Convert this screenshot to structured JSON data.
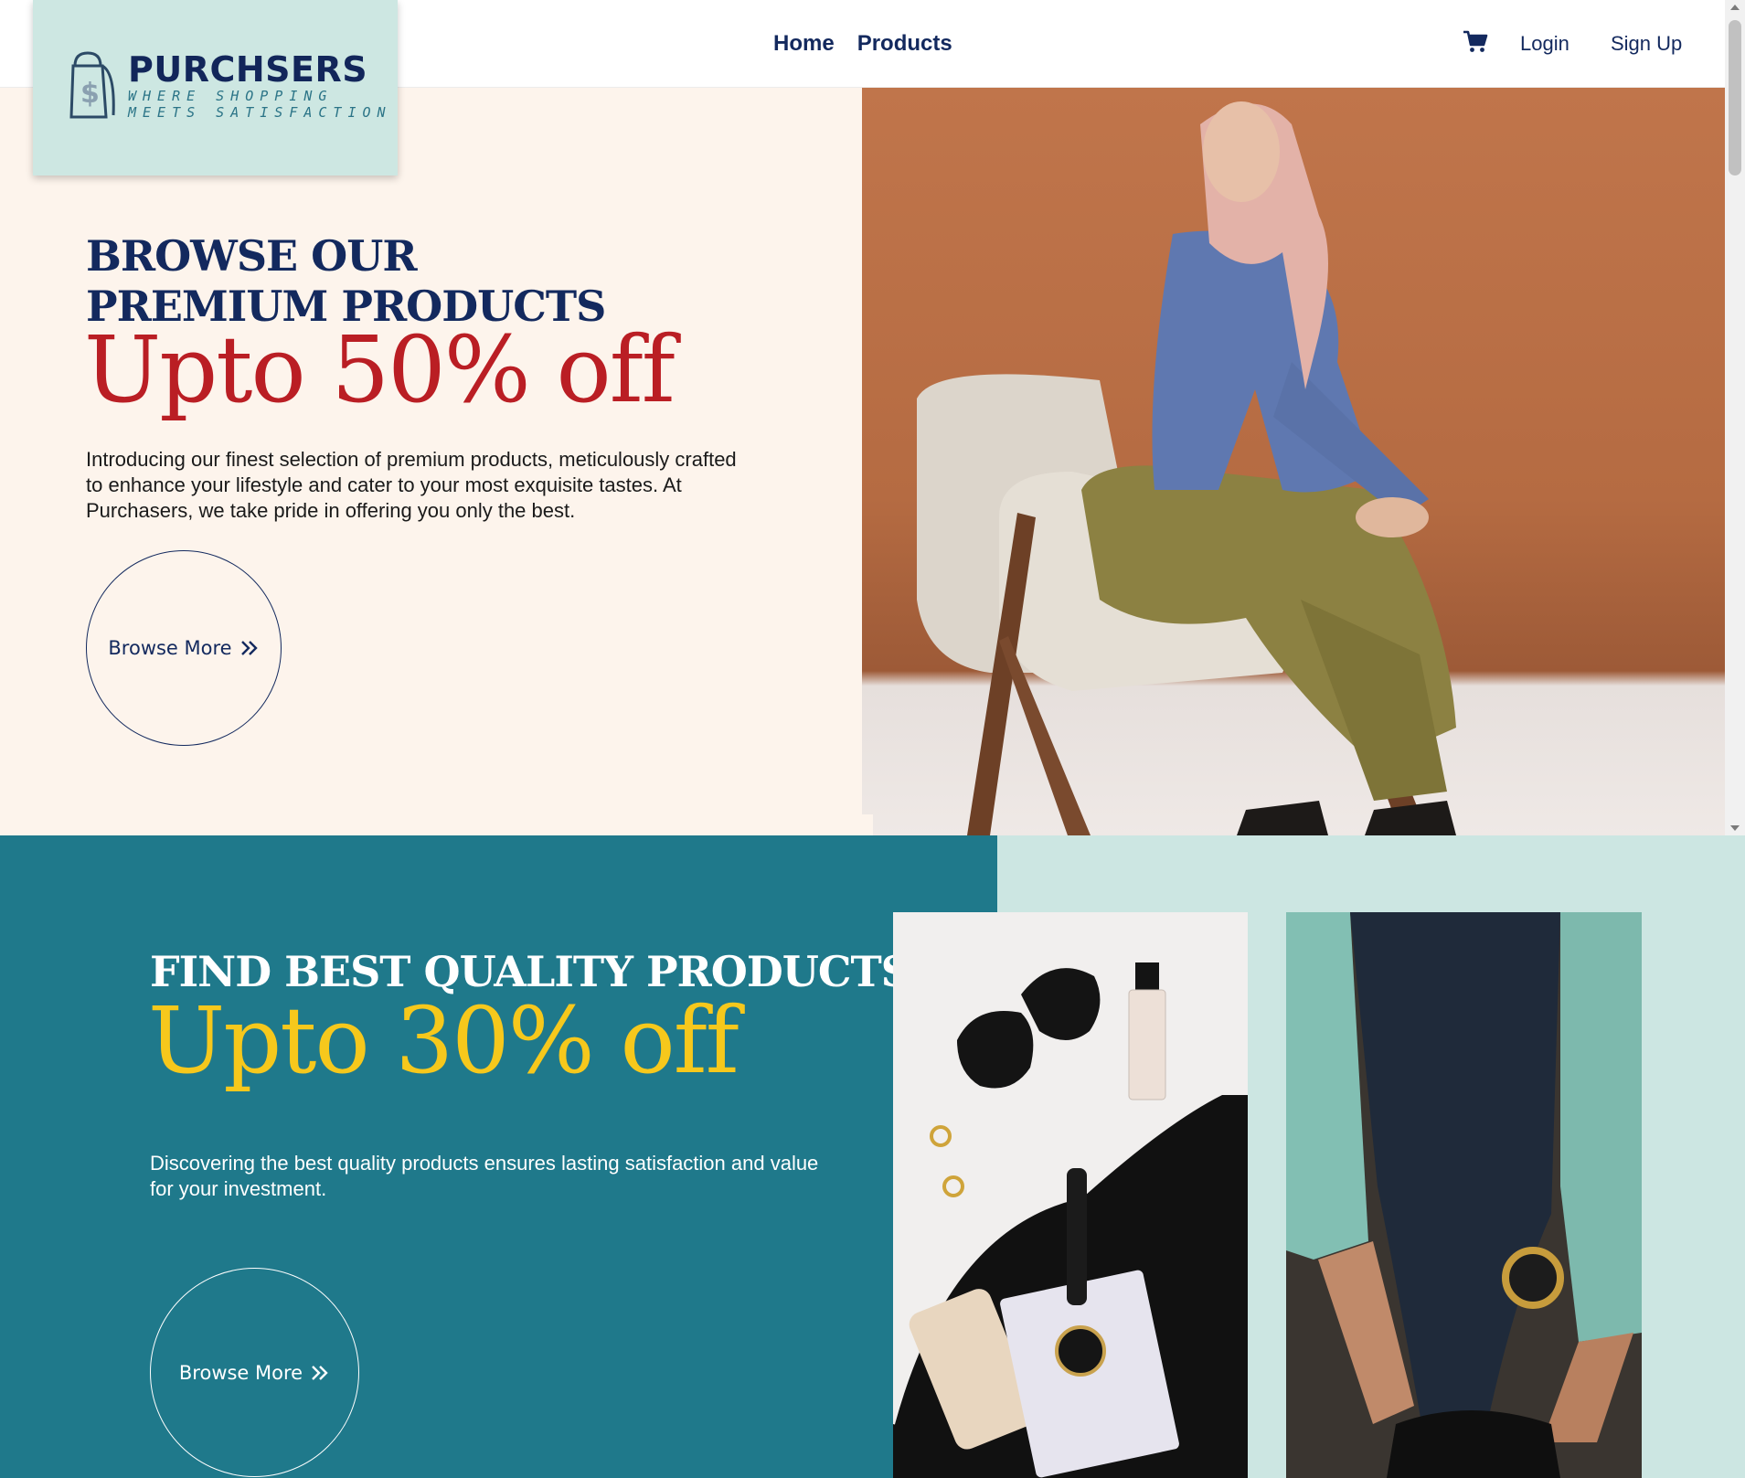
{
  "brand": {
    "name": "PURCHSERS",
    "tagline_line1": "WHERE SHOPPING",
    "tagline_line2": "MEETS SATISFACTION",
    "colors": {
      "navy": "#13295e",
      "teal": "#1f798b",
      "mint": "#cde7e2",
      "red": "#ba1e24",
      "gold": "#f6c81c",
      "cream": "#fdf4ec"
    }
  },
  "nav": {
    "home": "Home",
    "products": "Products",
    "cart_icon": "shopping-cart-icon",
    "login": "Login",
    "signup": "Sign Up"
  },
  "hero1": {
    "title": "BROWSE OUR PREMIUM PRODUCTS",
    "discount": "Upto 50% off",
    "description": "Introducing our finest selection of premium products, meticulously crafted to enhance your lifestyle and cater to your most exquisite tastes. At Purchasers, we take pride in offering you only the best.",
    "button": "Browse More"
  },
  "hero2": {
    "title": "FIND BEST QUALITY PRODUCTS",
    "discount": "Upto 30% off",
    "description": "Discovering the best quality products ensures lasting satisfaction and value for your investment.",
    "button": "Browse More"
  }
}
